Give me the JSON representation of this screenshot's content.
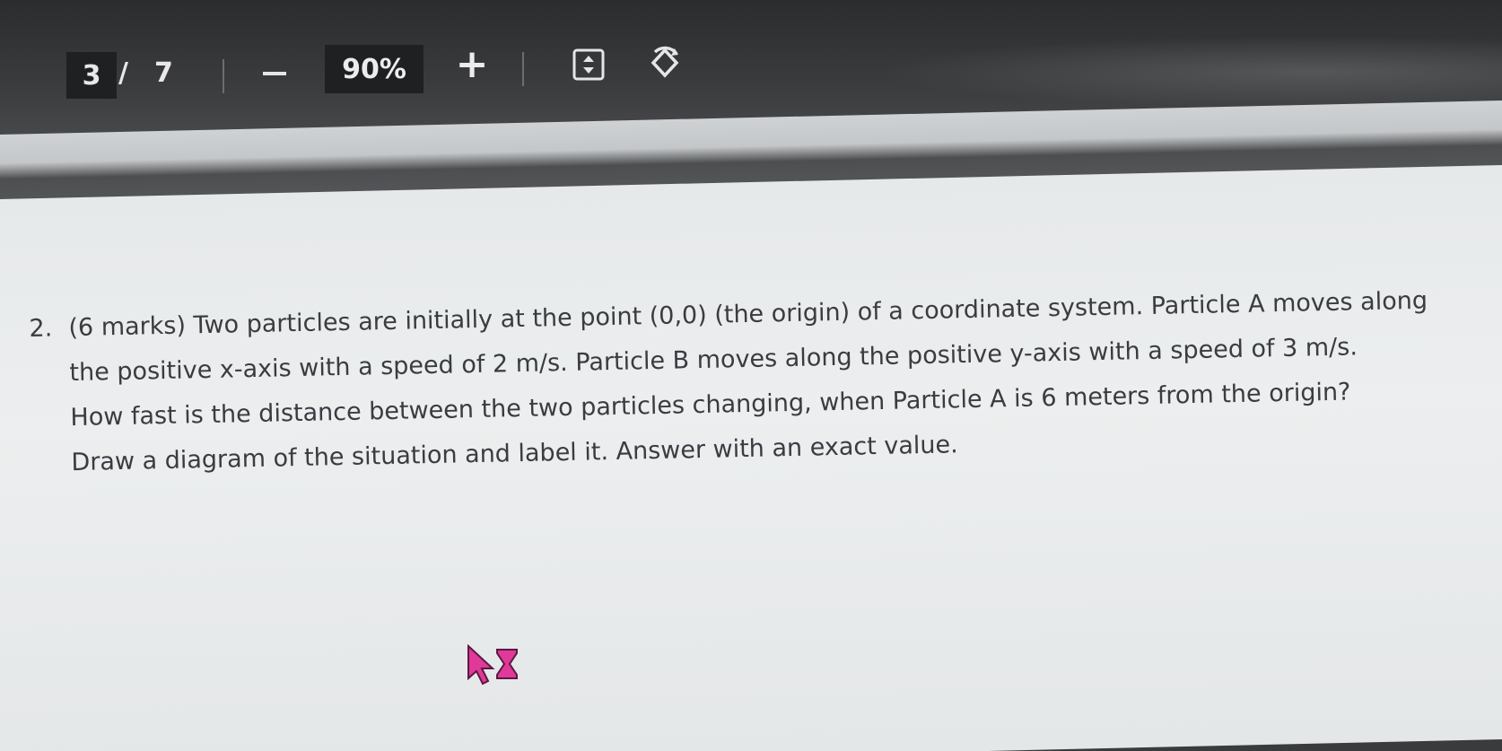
{
  "toolbar": {
    "current_page": "3",
    "page_separator": "/",
    "total_pages": "7",
    "zoom_out_icon": "minus-icon",
    "zoom_level": "90%",
    "zoom_in_label": "+",
    "fit_icon": "fit-page-icon",
    "rotate_icon": "rotate-icon"
  },
  "question": {
    "number": "2.",
    "lines": [
      "(6 marks) Two particles are initially at the point (0,0) (the origin) of a coordinate system. Particle A moves along",
      "the positive x-axis with a speed of 2 m/s. Particle B moves along the positive y-axis with a speed of 3 m/s.",
      "How fast is the distance between the two particles changing, when Particle A is 6 meters from the origin?",
      "Draw a diagram of the situation and label it. Answer with an exact value."
    ]
  },
  "cursor": {
    "icon": "busy-arrow-hourglass-icon",
    "color": "#e0399a"
  },
  "colors": {
    "toolbar_bg": "#3a3b3d",
    "page_bg": "#e8eaeb",
    "text": "#3a3c40"
  }
}
